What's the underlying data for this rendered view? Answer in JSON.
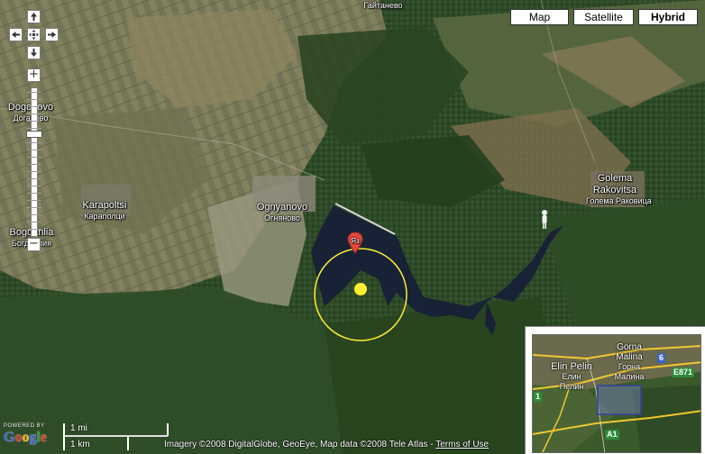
{
  "map": {
    "controls": {
      "pan_up_icon": "arrow-up",
      "pan_left_icon": "arrow-left",
      "pan_center_icon": "center-cross",
      "pan_right_icon": "arrow-right",
      "pan_down_icon": "arrow-down",
      "zoom_in_label": "+",
      "zoom_out_label": "−"
    },
    "map_types": [
      {
        "label": "Map",
        "active": false
      },
      {
        "label": "Satellite",
        "active": false
      },
      {
        "label": "Hybrid",
        "active": true
      }
    ],
    "places": [
      {
        "name": "Dogonovo",
        "native": "Доганово"
      },
      {
        "name": "Karapoltsi",
        "native": "Караполци"
      },
      {
        "name": "Ognyanovo",
        "native": "Огняново"
      },
      {
        "name": "Golema Rakovitsa",
        "native": "Голема Раковица"
      },
      {
        "name": "Bogdanlia",
        "native": "Богданлия"
      },
      {
        "name": "",
        "native": "Гайтанево"
      }
    ],
    "marker": {
      "label": "Яз",
      "color": "#e8473a"
    },
    "radius_circle_color": "#ffee33",
    "overview": {
      "places": [
        {
          "name": "Elin Pelin",
          "native": "Елин Пелин"
        },
        {
          "name": "Gorna Malina",
          "native": "Горна Малина"
        }
      ],
      "shields": [
        {
          "label": "6",
          "color": "#3a63c9"
        },
        {
          "label": "E871",
          "color": "#2e8b3a"
        },
        {
          "label": "A1",
          "color": "#2e8b3a"
        },
        {
          "label": "1",
          "color": "#2e8b3a"
        }
      ]
    },
    "scale": {
      "imperial": "1 mi",
      "metric": "1 km"
    },
    "attribution": "Imagery ©2008 DigitalGlobe, GeoEye, Map data ©2008 Tele Atlas - ",
    "terms_link": "Terms of Use",
    "logo": {
      "powered": "POWERED BY",
      "word": "Google"
    }
  }
}
